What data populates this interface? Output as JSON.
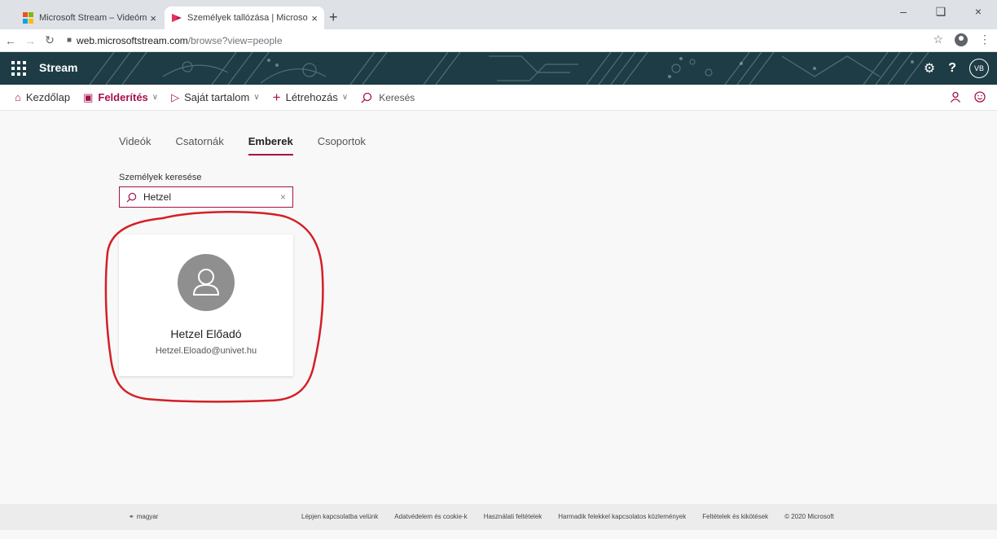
{
  "browser": {
    "tabs": [
      {
        "label": "Microsoft Stream – Videómegosz",
        "active": false
      },
      {
        "label": "Személyek tallózása | Microsoft S",
        "active": true
      }
    ],
    "new_tab": "+",
    "close_glyph": "×",
    "url_host": "web.microsoftstream.com",
    "url_path": "/browse?view=people"
  },
  "header": {
    "brand": "Stream",
    "avatar_initials": "VB",
    "help": "?"
  },
  "nav": {
    "home": "Kezdőlap",
    "discover": "Felderítés",
    "my_content": "Saját tartalom",
    "create": "Létrehozás",
    "search": "Keresés"
  },
  "pivots": [
    "Videók",
    "Csatornák",
    "Emberek",
    "Csoportok"
  ],
  "search": {
    "label": "Személyek keresése",
    "value": "Hetzel",
    "placeholder": ""
  },
  "person": {
    "name": "Hetzel Előadó",
    "email": "Hetzel.Eloado@univet.hu"
  },
  "footer": {
    "language": "magyar",
    "links": [
      "Lépjen kapcsolatba velünk",
      "Adatvédelem és cookie-k",
      "Használati feltételek",
      "Harmadik felekkel kapcsolatos közlemények",
      "Feltételek és kikötések",
      "© 2020 Microsoft"
    ]
  },
  "colors": {
    "accent": "#a4124b",
    "header_bg": "#1d3c45",
    "highlight": "#d41f26"
  }
}
